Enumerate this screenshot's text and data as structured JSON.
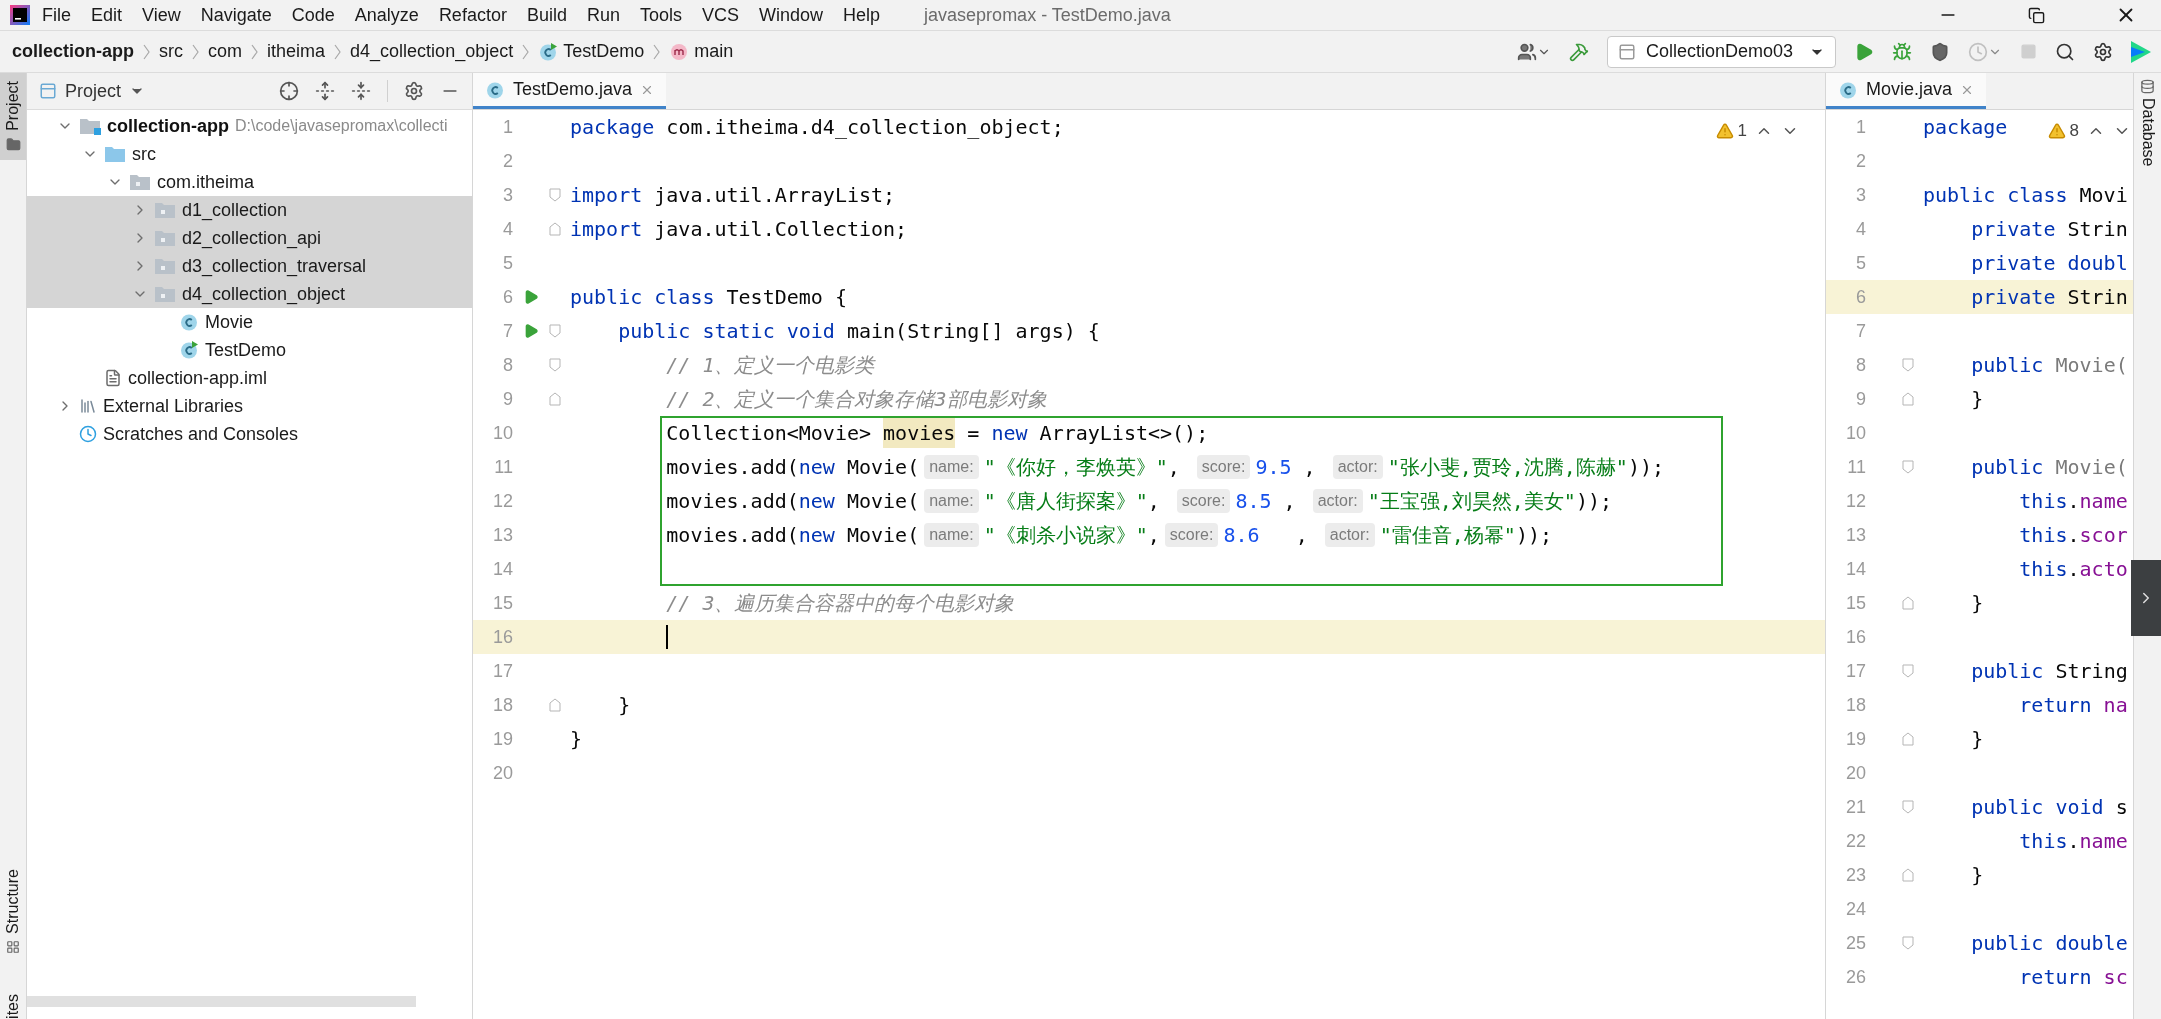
{
  "title_bar": {
    "menu": [
      "File",
      "Edit",
      "View",
      "Navigate",
      "Code",
      "Analyze",
      "Refactor",
      "Build",
      "Run",
      "Tools",
      "VCS",
      "Window",
      "Help"
    ],
    "title": "javasepromax - TestDemo.java"
  },
  "breadcrumbs": [
    {
      "label": "collection-app",
      "kind": "module"
    },
    {
      "label": "src",
      "kind": "folder"
    },
    {
      "label": "com",
      "kind": "folder"
    },
    {
      "label": "itheima",
      "kind": "folder"
    },
    {
      "label": "d4_collection_object",
      "kind": "folder"
    },
    {
      "label": "TestDemo",
      "kind": "class"
    },
    {
      "label": "main",
      "kind": "method"
    }
  ],
  "toolbar": {
    "run_configuration": "CollectionDemo03"
  },
  "side_stripes": {
    "left_top": {
      "label": "Project",
      "selected": true
    },
    "left_bottom": [
      "Structure",
      "ites"
    ],
    "right": "Database"
  },
  "project": {
    "title": "Project",
    "tree": [
      {
        "label": "collection-app",
        "kind": "module",
        "path": "D:\\code\\javasepromax\\collecti",
        "expanded": true,
        "selected": false,
        "children": [
          {
            "label": "src",
            "kind": "source",
            "expanded": true,
            "selected": false,
            "children": [
              {
                "label": "com.itheima",
                "kind": "package",
                "expanded": true,
                "selected": false,
                "children": [
                  {
                    "label": "d1_collection",
                    "kind": "package",
                    "expanded": false,
                    "selected": true
                  },
                  {
                    "label": "d2_collection_api",
                    "kind": "package",
                    "expanded": false,
                    "selected": true
                  },
                  {
                    "label": "d3_collection_traversal",
                    "kind": "package",
                    "expanded": false,
                    "selected": true
                  },
                  {
                    "label": "d4_collection_object",
                    "kind": "package",
                    "expanded": true,
                    "selected": true,
                    "children": [
                      {
                        "label": "Movie",
                        "kind": "class",
                        "selected": false
                      },
                      {
                        "label": "TestDemo",
                        "kind": "runnable_class",
                        "selected": false
                      }
                    ]
                  }
                ]
              }
            ]
          },
          {
            "label": "collection-app.iml",
            "kind": "iml",
            "selected": false
          }
        ]
      },
      {
        "label": "External Libraries",
        "kind": "libraries",
        "expanded": false,
        "selected": false
      },
      {
        "label": "Scratches and Consoles",
        "kind": "scratches",
        "selected": false
      }
    ]
  },
  "editors": [
    {
      "tab": {
        "label": "TestDemo.java",
        "selected": true
      },
      "warnings": "1",
      "lines": [
        {
          "number": "1",
          "run": false,
          "current": false,
          "boxed": false,
          "tokens": [
            {
              "kind": "keyword",
              "text": "package"
            },
            {
              "kind": "plain",
              "text": " com.itheima.d4_collection_object;"
            }
          ]
        },
        {
          "number": "2",
          "run": false,
          "current": false,
          "boxed": false
        },
        {
          "number": "3",
          "run": false,
          "current": false,
          "boxed": false,
          "fold": {
            "kind": "start"
          },
          "tokens": [
            {
              "kind": "keyword",
              "text": "import"
            },
            {
              "kind": "plain",
              "text": " java.util.ArrayList;"
            }
          ]
        },
        {
          "number": "4",
          "run": false,
          "current": false,
          "boxed": false,
          "fold": {
            "kind": "end"
          },
          "tokens": [
            {
              "kind": "keyword",
              "text": "import"
            },
            {
              "kind": "plain",
              "text": " java.util.Collection;"
            }
          ]
        },
        {
          "number": "5",
          "run": false,
          "current": false,
          "boxed": false
        },
        {
          "number": "6",
          "run": true,
          "current": false,
          "boxed": false,
          "tokens": [
            {
              "kind": "keyword",
              "text": "public class"
            },
            {
              "kind": "plain",
              "text": " TestDemo {"
            }
          ]
        },
        {
          "number": "7",
          "run": true,
          "current": false,
          "boxed": false,
          "fold": {
            "kind": "start"
          },
          "tokens": [
            {
              "kind": "keyword",
              "text": "    public static void"
            },
            {
              "kind": "plain",
              "text": " main(String[] args) {"
            }
          ]
        },
        {
          "number": "8",
          "run": false,
          "current": false,
          "boxed": false,
          "fold": {
            "kind": "start"
          },
          "tokens": [
            {
              "kind": "comment",
              "text": "        // 1、定义一个电影类"
            }
          ]
        },
        {
          "number": "9",
          "run": false,
          "current": false,
          "boxed": false,
          "fold": {
            "kind": "end"
          },
          "tokens": [
            {
              "kind": "comment",
              "text": "        // 2、定义一个集合对象存储3部电影对象"
            }
          ]
        },
        {
          "number": "10",
          "run": false,
          "current": false,
          "boxed": true,
          "tokens": [
            {
              "kind": "plain",
              "text": "        Collection<Movie> "
            },
            {
              "kind": "highlight",
              "text": "movies"
            },
            {
              "kind": "plain",
              "text": " = "
            },
            {
              "kind": "keyword",
              "text": "new"
            },
            {
              "kind": "plain",
              "text": " ArrayList<>();"
            }
          ]
        },
        {
          "number": "11",
          "run": false,
          "current": false,
          "boxed": true,
          "tokens": [
            {
              "kind": "plain",
              "text": "        movies.add("
            },
            {
              "kind": "keyword",
              "text": "new"
            },
            {
              "kind": "plain",
              "text": " Movie("
            },
            {
              "kind": "hint",
              "text": "name:"
            },
            {
              "kind": "string",
              "text": "\"《你好，李焕英》\""
            },
            {
              "kind": "plain",
              "text": ", "
            },
            {
              "kind": "hint",
              "text": "score:"
            },
            {
              "kind": "number",
              "text": "9.5"
            },
            {
              "kind": "plain",
              "text": " , "
            },
            {
              "kind": "hint",
              "text": "actor:"
            },
            {
              "kind": "string",
              "text": "\"张小斐,贾玲,沈腾,陈赫\""
            },
            {
              "kind": "plain",
              "text": "));"
            }
          ]
        },
        {
          "number": "12",
          "run": false,
          "current": false,
          "boxed": true,
          "tokens": [
            {
              "kind": "plain",
              "text": "        movies.add("
            },
            {
              "kind": "keyword",
              "text": "new"
            },
            {
              "kind": "plain",
              "text": " Movie("
            },
            {
              "kind": "hint",
              "text": "name:"
            },
            {
              "kind": "string",
              "text": "\"《唐人街探案》\""
            },
            {
              "kind": "plain",
              "text": ", "
            },
            {
              "kind": "hint",
              "text": "score:"
            },
            {
              "kind": "number",
              "text": "8.5"
            },
            {
              "kind": "plain",
              "text": " , "
            },
            {
              "kind": "hint",
              "text": "actor:"
            },
            {
              "kind": "string",
              "text": "\"王宝强,刘昊然,美女\""
            },
            {
              "kind": "plain",
              "text": "));"
            }
          ]
        },
        {
          "number": "13",
          "run": false,
          "current": false,
          "boxed": true,
          "tokens": [
            {
              "kind": "plain",
              "text": "        movies.add("
            },
            {
              "kind": "keyword",
              "text": "new"
            },
            {
              "kind": "plain",
              "text": " Movie("
            },
            {
              "kind": "hint",
              "text": "name:"
            },
            {
              "kind": "string",
              "text": "\"《刺杀小说家》\""
            },
            {
              "kind": "plain",
              "text": ","
            },
            {
              "kind": "hint",
              "text": "score:"
            },
            {
              "kind": "number",
              "text": "8.6"
            },
            {
              "kind": "plain",
              "text": "   , "
            },
            {
              "kind": "hint",
              "text": "actor:"
            },
            {
              "kind": "string",
              "text": "\"雷佳音,杨幂\""
            },
            {
              "kind": "plain",
              "text": "));"
            }
          ]
        },
        {
          "number": "14",
          "run": false,
          "current": false,
          "boxed": true
        },
        {
          "number": "15",
          "run": false,
          "current": false,
          "boxed": false,
          "tokens": [
            {
              "kind": "comment",
              "text": "        // 3、遍历集合容器中的每个电影对象"
            }
          ]
        },
        {
          "number": "16",
          "run": false,
          "current": true,
          "boxed": false,
          "tokens": [
            {
              "kind": "caret"
            }
          ]
        },
        {
          "number": "17",
          "run": false,
          "current": false,
          "boxed": false
        },
        {
          "number": "18",
          "run": false,
          "current": false,
          "boxed": false,
          "fold": {
            "kind": "end"
          },
          "tokens": [
            {
              "kind": "plain",
              "text": "    }"
            }
          ]
        },
        {
          "number": "19",
          "run": false,
          "current": false,
          "boxed": false,
          "tokens": [
            {
              "kind": "plain",
              "text": "}"
            }
          ]
        },
        {
          "number": "20",
          "run": false,
          "current": false,
          "boxed": false
        }
      ]
    },
    {
      "tab": {
        "label": "Movie.java",
        "selected": true
      },
      "warnings": "8",
      "lines": [
        {
          "number": "1",
          "current": false,
          "tokens": [
            {
              "kind": "keyword",
              "text": "package"
            }
          ]
        },
        {
          "number": "2",
          "current": false
        },
        {
          "number": "3",
          "current": false,
          "tokens": [
            {
              "kind": "keyword",
              "text": "public class"
            },
            {
              "kind": "plain",
              "text": " Movi"
            }
          ]
        },
        {
          "number": "4",
          "current": false,
          "tokens": [
            {
              "kind": "keyword",
              "text": "    private"
            },
            {
              "kind": "plain",
              "text": " Strin"
            }
          ]
        },
        {
          "number": "5",
          "current": false,
          "tokens": [
            {
              "kind": "keyword",
              "text": "    private doubl"
            }
          ]
        },
        {
          "number": "6",
          "current": true,
          "tokens": [
            {
              "kind": "keyword",
              "text": "    private"
            },
            {
              "kind": "plain",
              "text": " Strin"
            }
          ]
        },
        {
          "number": "7",
          "current": false
        },
        {
          "number": "8",
          "current": false,
          "fold": {
            "kind": "start"
          },
          "tokens": [
            {
              "kind": "keyword",
              "text": "    public"
            },
            {
              "kind": "unused",
              "text": " Movie("
            }
          ]
        },
        {
          "number": "9",
          "current": false,
          "fold": {
            "kind": "end"
          },
          "tokens": [
            {
              "kind": "plain",
              "text": "    }"
            }
          ]
        },
        {
          "number": "10",
          "current": false
        },
        {
          "number": "11",
          "current": false,
          "fold": {
            "kind": "start"
          },
          "tokens": [
            {
              "kind": "keyword",
              "text": "    public"
            },
            {
              "kind": "unused",
              "text": " Movie("
            }
          ]
        },
        {
          "number": "12",
          "current": false,
          "tokens": [
            {
              "kind": "keyword",
              "text": "        this"
            },
            {
              "kind": "plain",
              "text": "."
            },
            {
              "kind": "field",
              "text": "name"
            }
          ]
        },
        {
          "number": "13",
          "current": false,
          "tokens": [
            {
              "kind": "keyword",
              "text": "        this"
            },
            {
              "kind": "plain",
              "text": "."
            },
            {
              "kind": "field",
              "text": "scor"
            }
          ]
        },
        {
          "number": "14",
          "current": false,
          "tokens": [
            {
              "kind": "keyword",
              "text": "        this"
            },
            {
              "kind": "plain",
              "text": "."
            },
            {
              "kind": "field",
              "text": "acto"
            }
          ]
        },
        {
          "number": "15",
          "current": false,
          "fold": {
            "kind": "end"
          },
          "tokens": [
            {
              "kind": "plain",
              "text": "    }"
            }
          ]
        },
        {
          "number": "16",
          "current": false
        },
        {
          "number": "17",
          "current": false,
          "fold": {
            "kind": "start"
          },
          "tokens": [
            {
              "kind": "keyword",
              "text": "    public"
            },
            {
              "kind": "plain",
              "text": " String"
            }
          ]
        },
        {
          "number": "18",
          "current": false,
          "tokens": [
            {
              "kind": "keyword",
              "text": "        return"
            },
            {
              "kind": "field",
              "text": " na"
            }
          ]
        },
        {
          "number": "19",
          "current": false,
          "fold": {
            "kind": "end"
          },
          "tokens": [
            {
              "kind": "plain",
              "text": "    }"
            }
          ]
        },
        {
          "number": "20",
          "current": false
        },
        {
          "number": "21",
          "current": false,
          "fold": {
            "kind": "start"
          },
          "tokens": [
            {
              "kind": "keyword",
              "text": "    public void"
            },
            {
              "kind": "plain",
              "text": " s"
            }
          ]
        },
        {
          "number": "22",
          "current": false,
          "tokens": [
            {
              "kind": "keyword",
              "text": "        this"
            },
            {
              "kind": "plain",
              "text": "."
            },
            {
              "kind": "field",
              "text": "name"
            }
          ]
        },
        {
          "number": "23",
          "current": false,
          "fold": {
            "kind": "end"
          },
          "tokens": [
            {
              "kind": "plain",
              "text": "    }"
            }
          ]
        },
        {
          "number": "24",
          "current": false
        },
        {
          "number": "25",
          "current": false,
          "fold": {
            "kind": "start"
          },
          "tokens": [
            {
              "kind": "keyword",
              "text": "    public double"
            }
          ]
        },
        {
          "number": "26",
          "current": false,
          "tokens": [
            {
              "kind": "keyword",
              "text": "        return"
            },
            {
              "kind": "field",
              "text": " sc"
            }
          ]
        }
      ]
    }
  ]
}
